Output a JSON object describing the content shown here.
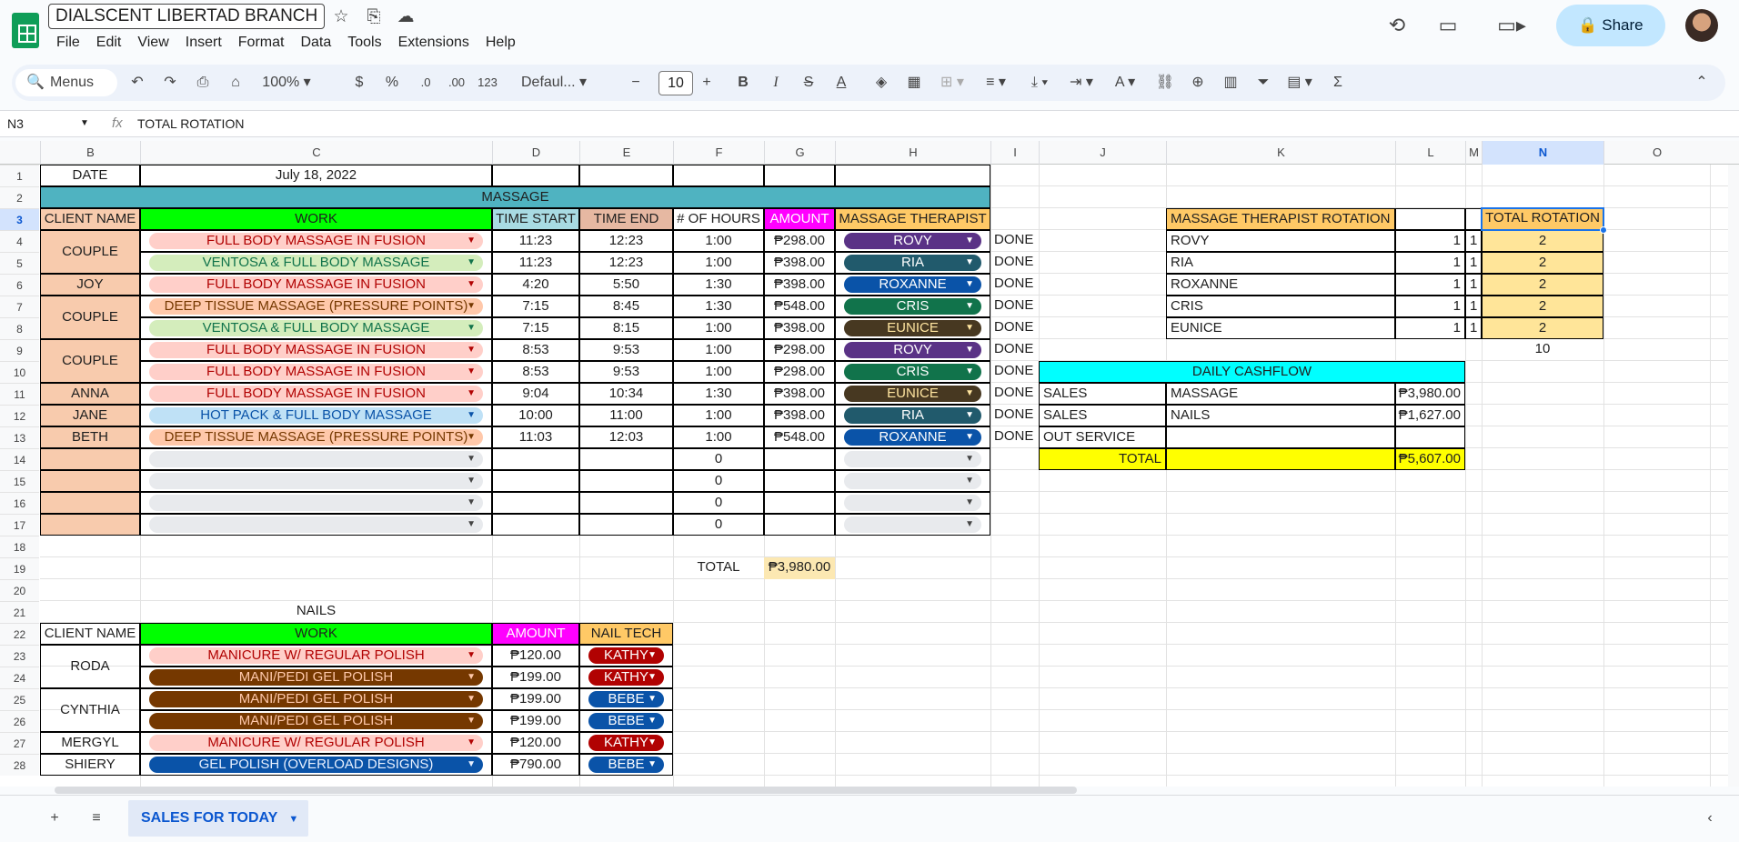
{
  "app": {
    "doc_title": "DIALSCENT LIBERTAD BRANCH",
    "menu": [
      "File",
      "Edit",
      "View",
      "Insert",
      "Format",
      "Data",
      "Tools",
      "Extensions",
      "Help"
    ],
    "share_label": "Share"
  },
  "toolbar": {
    "menus_label": "Menus",
    "zoom": "100%",
    "currency": "$",
    "percent": "%",
    "dec_decrease": ".0",
    "dec_increase": ".00",
    "number_format": "123",
    "font": "Defaul...",
    "font_size": "10"
  },
  "formula_bar": {
    "cell_ref": "N3",
    "fx": "fx",
    "value": "TOTAL ROTATION"
  },
  "columns": [
    "B",
    "C",
    "D",
    "E",
    "F",
    "G",
    "H",
    "I",
    "J",
    "K",
    "L",
    "M",
    "N",
    "O"
  ],
  "rows": [
    "1",
    "2",
    "3",
    "4",
    "5",
    "6",
    "7",
    "8",
    "9",
    "10",
    "11",
    "12",
    "13",
    "14",
    "15",
    "16",
    "17",
    "18",
    "19",
    "20",
    "21",
    "22",
    "23",
    "24",
    "25",
    "26",
    "27",
    "28"
  ],
  "sheet": {
    "date_label": "DATE",
    "date_value": "July 18, 2022",
    "massage_title": "MASSAGE",
    "headers": {
      "client": "CLIENT NAME",
      "work": "WORK",
      "start": "TIME START",
      "end": "TIME END",
      "hours": "# OF HOURS",
      "amount": "AMOUNT",
      "therapist": "MASSAGE THERAPIST"
    },
    "massage_rows": [
      {
        "work": "FULL BODY MASSAGE IN FUSION",
        "start": "11:23",
        "end": "12:23",
        "hours": "1:00",
        "amount": "₱298.00",
        "therapist": "ROVY",
        "status": "DONE"
      },
      {
        "work": "VENTOSA & FULL BODY MASSAGE",
        "start": "11:23",
        "end": "12:23",
        "hours": "1:00",
        "amount": "₱398.00",
        "therapist": "RIA",
        "status": "DONE"
      },
      {
        "work": "FULL BODY MASSAGE IN FUSION",
        "start": "4:20",
        "end": "5:50",
        "hours": "1:30",
        "amount": "₱398.00",
        "therapist": "ROXANNE",
        "status": "DONE"
      },
      {
        "work": "DEEP TISSUE MASSAGE (PRESSURE POINTS)",
        "start": "7:15",
        "end": "8:45",
        "hours": "1:30",
        "amount": "₱548.00",
        "therapist": "CRIS",
        "status": "DONE"
      },
      {
        "work": "VENTOSA & FULL BODY MASSAGE",
        "start": "7:15",
        "end": "8:15",
        "hours": "1:00",
        "amount": "₱398.00",
        "therapist": "EUNICE",
        "status": "DONE"
      },
      {
        "work": "FULL BODY MASSAGE IN FUSION",
        "start": "8:53",
        "end": "9:53",
        "hours": "1:00",
        "amount": "₱298.00",
        "therapist": "ROVY",
        "status": "DONE"
      },
      {
        "work": "FULL BODY MASSAGE IN FUSION",
        "start": "8:53",
        "end": "9:53",
        "hours": "1:00",
        "amount": "₱298.00",
        "therapist": "CRIS",
        "status": "DONE"
      },
      {
        "work": "FULL BODY MASSAGE IN FUSION",
        "start": "9:04",
        "end": "10:34",
        "hours": "1:30",
        "amount": "₱398.00",
        "therapist": "EUNICE",
        "status": "DONE"
      },
      {
        "work": "HOT PACK & FULL BODY MASSAGE",
        "start": "10:00",
        "end": "11:00",
        "hours": "1:00",
        "amount": "₱398.00",
        "therapist": "RIA",
        "status": "DONE"
      },
      {
        "work": "DEEP TISSUE MASSAGE (PRESSURE POINTS)",
        "start": "11:03",
        "end": "12:03",
        "hours": "1:00",
        "amount": "₱548.00",
        "therapist": "ROXANNE",
        "status": "DONE"
      }
    ],
    "clients": [
      "COUPLE",
      "JOY",
      "COUPLE",
      "COUPLE",
      "ANNA",
      "JANE",
      "BETH"
    ],
    "empty_hours": "0",
    "total_label": "TOTAL",
    "total_amount": "₱3,980.00",
    "rotation": {
      "title": "MASSAGE THERAPIST ROTATION",
      "total_title": "TOTAL ROTATION",
      "rows": [
        {
          "name": "ROVY",
          "l": "1",
          "m": "1",
          "total": "2"
        },
        {
          "name": "RIA",
          "l": "1",
          "m": "1",
          "total": "2"
        },
        {
          "name": "ROXANNE",
          "l": "1",
          "m": "1",
          "total": "2"
        },
        {
          "name": "CRIS",
          "l": "1",
          "m": "1",
          "total": "2"
        },
        {
          "name": "EUNICE",
          "l": "1",
          "m": "1",
          "total": "2"
        }
      ],
      "sum": "10"
    },
    "cashflow": {
      "title": "DAILY CASHFLOW",
      "rows": [
        {
          "a": "SALES",
          "b": "MASSAGE",
          "c": "₱3,980.00"
        },
        {
          "a": "SALES",
          "b": "NAILS",
          "c": "₱1,627.00"
        },
        {
          "a": "OUT SERVICE",
          "b": "",
          "c": ""
        }
      ],
      "total_label": "TOTAL",
      "total_value": "₱5,607.00"
    },
    "nails": {
      "title": "NAILS",
      "headers": {
        "client": "CLIENT NAME",
        "work": "WORK",
        "amount": "AMOUNT",
        "tech": "NAIL TECH"
      },
      "clients": [
        "RODA",
        "CYNTHIA",
        "MERGYL",
        "SHIERY"
      ],
      "rows": [
        {
          "work": "MANICURE W/ REGULAR POLISH",
          "amount": "₱120.00",
          "tech": "KATHY"
        },
        {
          "work": "MANI/PEDI GEL POLISH",
          "amount": "₱199.00",
          "tech": "KATHY"
        },
        {
          "work": "MANI/PEDI GEL POLISH",
          "amount": "₱199.00",
          "tech": "BEBE"
        },
        {
          "work": "MANI/PEDI GEL POLISH",
          "amount": "₱199.00",
          "tech": "BEBE"
        },
        {
          "work": "MANICURE W/ REGULAR POLISH",
          "amount": "₱120.00",
          "tech": "KATHY"
        },
        {
          "work": "GEL POLISH (OVERLOAD DESIGNS)",
          "amount": "₱790.00",
          "tech": "BEBE"
        }
      ]
    }
  },
  "sheet_tab": "SALES FOR TODAY",
  "colors": {
    "teal": "#4fb3c1",
    "green": "#00ff00",
    "peach": "#f8cbad",
    "salmon": "#e6b8a2",
    "magenta": "#ff00ff",
    "orange": "#ffc966",
    "cyan": "#00ffff",
    "yellow": "#ffff00",
    "light_orange": "#ffe599"
  }
}
